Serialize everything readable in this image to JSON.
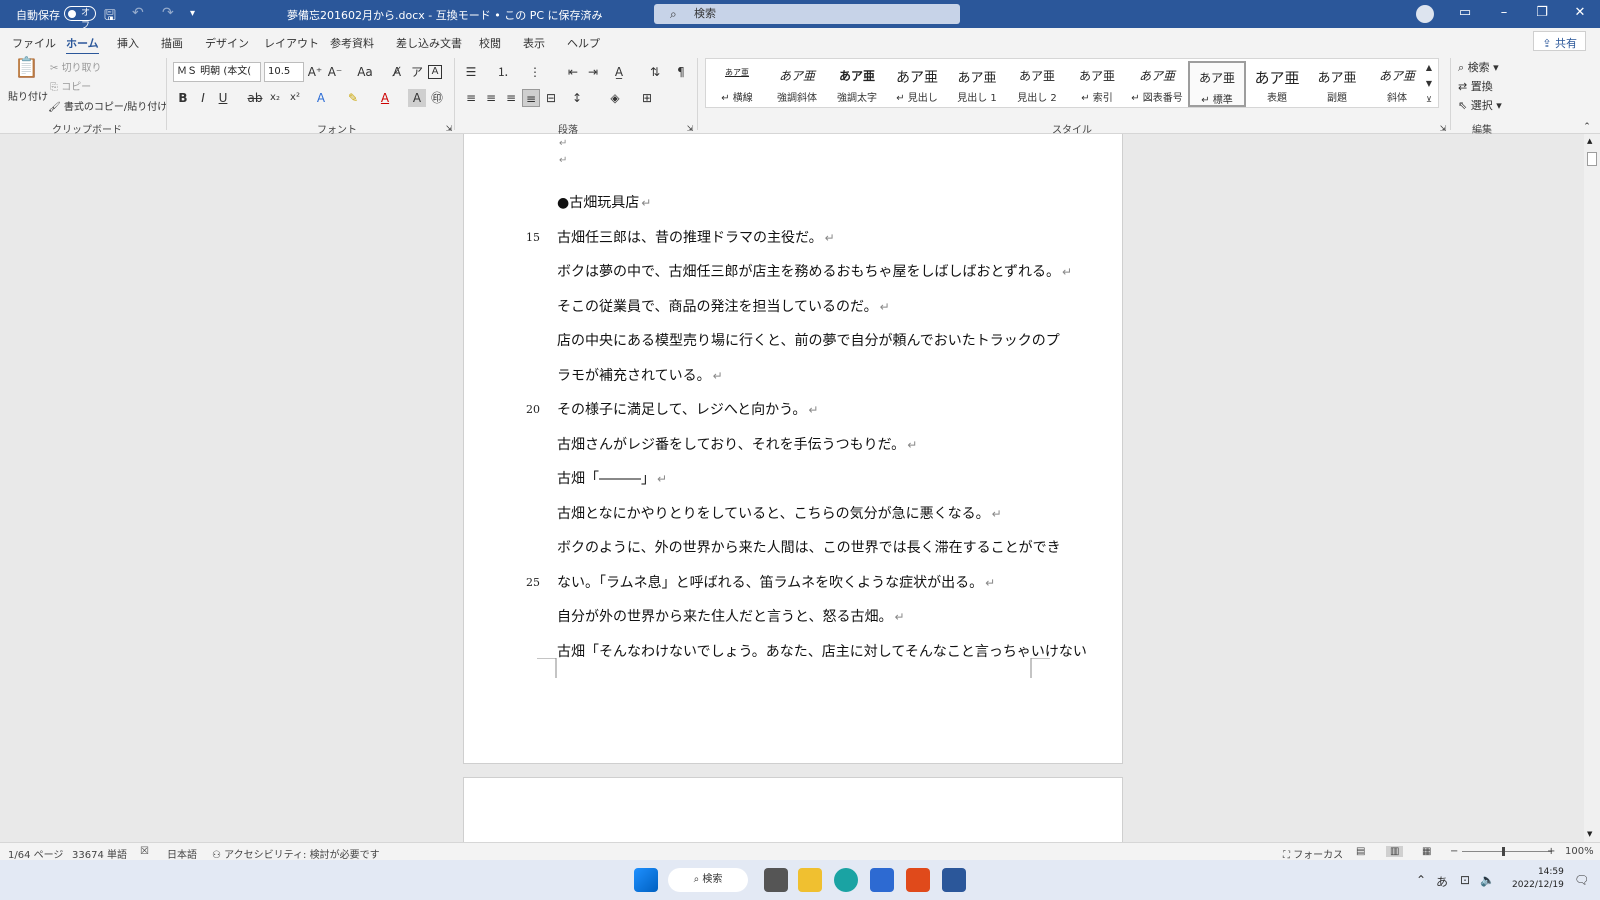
{
  "titlebar": {
    "autosave_label": "自動保存",
    "autosave_state": "オフ",
    "doc_title": "夢備忘201602月から.docx - 互換モード • この PC に保存済み",
    "search_placeholder": "検索"
  },
  "tabs": [
    "ファイル",
    "ホーム",
    "挿入",
    "描画",
    "デザイン",
    "レイアウト",
    "参考資料",
    "差し込み文書",
    "校閲",
    "表示",
    "ヘルプ"
  ],
  "active_tab": "ホーム",
  "share_label": "共有",
  "ribbon": {
    "clipboard": {
      "paste": "貼り付け",
      "cut": "切り取り",
      "copy": "コピー",
      "format_painter": "書式のコピー/貼り付け",
      "group_label": "クリップボード"
    },
    "font": {
      "font_name": "ＭＳ 明朝 (本文(",
      "font_size": "10.5",
      "group_label": "フォント"
    },
    "paragraph": {
      "group_label": "段落"
    },
    "styles": {
      "group_label": "スタイル",
      "items": [
        {
          "preview": "あア亜",
          "name": "↵ 横線"
        },
        {
          "preview": "あア亜",
          "name": "強調斜体"
        },
        {
          "preview": "あア亜",
          "name": "強調太字"
        },
        {
          "preview": "あア亜",
          "name": "↵ 見出し"
        },
        {
          "preview": "あア亜",
          "name": "見出し 1"
        },
        {
          "preview": "あア亜",
          "name": "見出し 2"
        },
        {
          "preview": "あア亜",
          "name": "↵ 索引"
        },
        {
          "preview": "あア亜",
          "name": "↵ 図表番号"
        },
        {
          "preview": "あア亜",
          "name": "↵ 標準"
        },
        {
          "preview": "あア亜",
          "name": "表題"
        },
        {
          "preview": "あア亜",
          "name": "副題"
        },
        {
          "preview": "あア亜",
          "name": "斜体"
        }
      ]
    },
    "editing": {
      "find": "検索",
      "replace": "置換",
      "select": "選択",
      "group_label": "編集"
    }
  },
  "document": {
    "paragraph_mark": "↵",
    "lines": [
      {
        "text": "",
        "num": ""
      },
      {
        "text": "",
        "num": ""
      },
      {
        "text": "●古畑玩具店",
        "num": ""
      },
      {
        "text": "古畑任三郎は、昔の推理ドラマの主役だ。",
        "num": "15"
      },
      {
        "text": "ボクは夢の中で、古畑任三郎が店主を務めるおもちゃ屋をしばしばおとずれる。",
        "num": ""
      },
      {
        "text": "そこの従業員で、商品の発注を担当しているのだ。",
        "num": ""
      },
      {
        "text": "店の中央にある模型売り場に行くと、前の夢で自分が頼んでおいたトラックのプ",
        "num": "",
        "nomark": true
      },
      {
        "text": "ラモが補充されている。",
        "num": ""
      },
      {
        "text": "その様子に満足して、レジへと向かう。",
        "num": "20"
      },
      {
        "text": "古畑さんがレジ番をしており、それを手伝うつもりだ。",
        "num": ""
      },
      {
        "text": "古畑「―――」",
        "num": ""
      },
      {
        "text": "古畑となにかやりとりをしていると、こちらの気分が急に悪くなる。",
        "num": ""
      },
      {
        "text": "ボクのように、外の世界から来た人間は、この世界では長く滞在することができ",
        "num": "",
        "nomark": true
      },
      {
        "text": "ない。「ラムネ息」と呼ばれる、笛ラムネを吹くような症状が出る。",
        "num": "25"
      },
      {
        "text": "自分が外の世界から来た住人だと言うと、怒る古畑。",
        "num": ""
      },
      {
        "text": "古畑「そんなわけないでしょう。あなた、店主に対してそんなこと言っちゃいけない",
        "num": "",
        "nomark": true
      }
    ]
  },
  "statusbar": {
    "page": "1/64 ページ",
    "words": "33674 単語",
    "language": "日本語",
    "accessibility": "アクセシビリティ: 検討が必要です",
    "focus": "フォーカス",
    "zoom": "100%"
  },
  "taskbar": {
    "search": "検索",
    "ime": "あ",
    "time": "14:59",
    "date": "2022/12/19"
  },
  "colors": {
    "word_blue": "#2b579a",
    "page": "#ffffff",
    "workspace": "#e9e9e9"
  }
}
